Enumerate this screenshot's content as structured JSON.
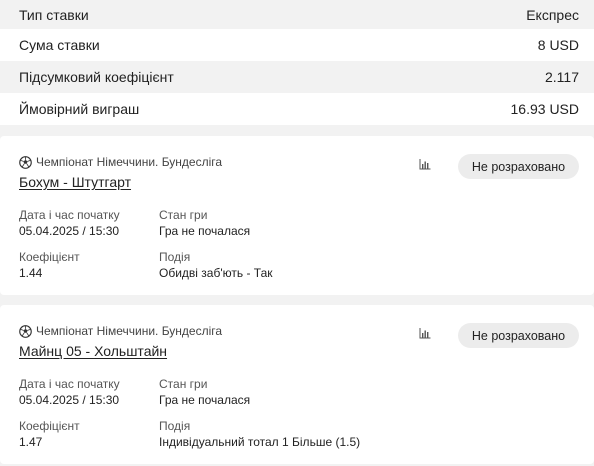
{
  "summary": {
    "rows": [
      {
        "label": "Тип ставки",
        "value": "Експрес"
      },
      {
        "label": "Сума ставки",
        "value": "8 USD"
      },
      {
        "label": "Підсумковий коефіцієнт",
        "value": "2.117"
      },
      {
        "label": "Ймовірний виграш",
        "value": "16.93 USD"
      }
    ]
  },
  "events": [
    {
      "league": "Чемпіонат Німеччини. Бундесліга",
      "match": "Бохум - Штутгарт",
      "status": "Не розраховано",
      "start_label": "Дата і час початку",
      "start_value": "05.04.2025 / 15:30",
      "state_label": "Стан гри",
      "state_value": "Гра не почалася",
      "odds_label": "Коефіцієнт",
      "odds_value": "1.44",
      "event_label": "Подія",
      "event_value": "Обидві заб'ють - Так"
    },
    {
      "league": "Чемпіонат Німеччини. Бундесліга",
      "match": "Майнц 05 - Хольштайн",
      "status": "Не розраховано",
      "start_label": "Дата і час початку",
      "start_value": "05.04.2025 / 15:30",
      "state_label": "Стан гри",
      "state_value": "Гра не почалася",
      "odds_label": "Коефіцієнт",
      "odds_value": "1.47",
      "event_label": "Подія",
      "event_value": "Індивідуальний тотал 1 Більше (1.5)"
    }
  ],
  "icons": {
    "league": "soccer-ball-icon",
    "stats": "statistics-icon"
  }
}
